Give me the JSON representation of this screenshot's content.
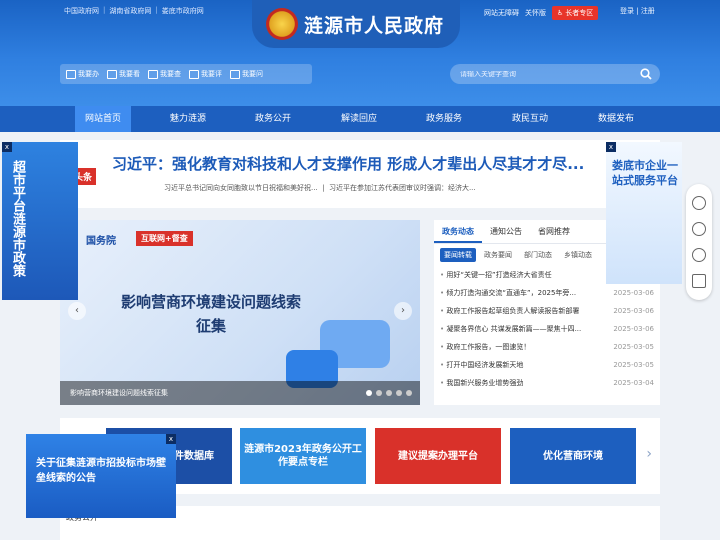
{
  "top_links": [
    "中国政府网",
    "湖南省政府网",
    "娄底市政府网"
  ],
  "top_right": {
    "accessible": "网站无障碍",
    "care": "关怀版",
    "elder": "长者专区",
    "login": "登录",
    "register": "注册"
  },
  "site_title": "涟源市人民政府",
  "quick_links": [
    "我要办",
    "我要看",
    "我要查",
    "我要评",
    "我要问"
  ],
  "search": {
    "placeholder": "请输入关键字查询"
  },
  "nav": [
    "网站首页",
    "魅力涟源",
    "政务公开",
    "解读回应",
    "政务服务",
    "政民互动",
    "数据发布"
  ],
  "headline": {
    "tag": "头条",
    "title": "习近平：强化教育对科技和人才支撑作用 形成人才辈出人尽其才才尽...",
    "sub1": "习近平总书记同向女同胞致以节日祝福和美好祝...",
    "sub2": "习近平在参加江苏代表团审议时强调：经济大..."
  },
  "slider": {
    "tag1": "国务院",
    "tag2": "互联网+督查",
    "title": "影响营商环境建设问题线索征集",
    "caption": "影响营商环境建设问题线索征集"
  },
  "news": {
    "tabs": [
      "政务动态",
      "通知公告",
      "省网推荐"
    ],
    "subtabs": [
      "要闻转载",
      "政务要闻",
      "部门动态",
      "乡镇动态"
    ],
    "items": [
      {
        "title": "用好“关键一招”打造经济大省责任",
        "date": ""
      },
      {
        "title": "倾力打造沟通交流“直通车”，2025年旁...",
        "date": "2025-03-06"
      },
      {
        "title": "政府工作报告起草组负责人解读报告新部署",
        "date": "2025-03-06"
      },
      {
        "title": "凝聚各界信心 共谋发展新篇——聚焦十四...",
        "date": "2025-03-06"
      },
      {
        "title": "政府工作报告，一图速览！",
        "date": "2025-03-05"
      },
      {
        "title": "打开中国经济发展新天地",
        "date": "2025-03-05"
      },
      {
        "title": "我国新兴服务业增势强劲",
        "date": "2025-03-04"
      }
    ]
  },
  "banners": [
    "法规规章文件数据库",
    "涟源市2023年政务公开工作要点专栏",
    "建议提案办理平台",
    "优化营商环境"
  ],
  "section": {
    "title": "政务公开"
  },
  "float_left": {
    "text": "超市平台涟源市政策",
    "close": "x"
  },
  "float_right": {
    "text": "娄底市企业一站式服务平台",
    "close": "x"
  },
  "float_bottom": {
    "text": "关于征集涟源市招投标市场壁垒线索的公告",
    "close": "x"
  },
  "colors": {
    "primary": "#1d5fbf",
    "accent": "#d9312a"
  }
}
